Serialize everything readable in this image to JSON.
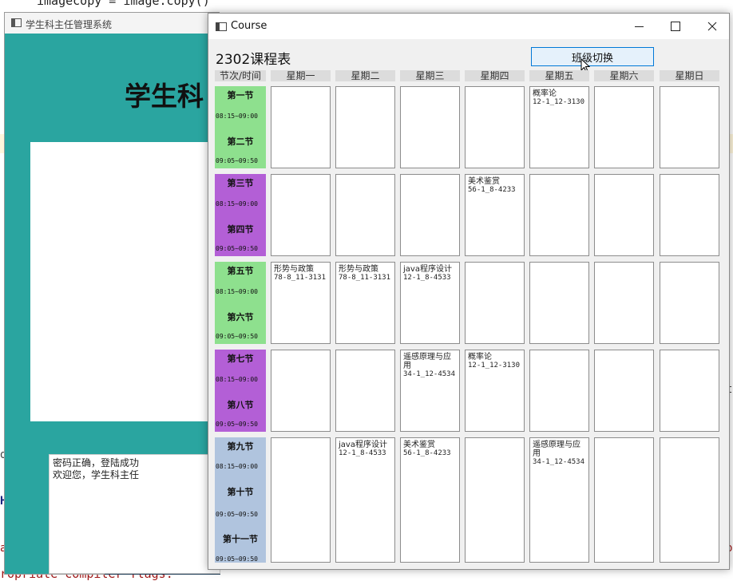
{
  "background": {
    "code_top": "imagecopy = image.copy()",
    "code_bottom": "ropriate compiler flags.",
    "right_fragment": "t",
    "right_fragment_b": "b",
    "left_fragment_d": "d",
    "left_fragment_h": "H",
    "left_fragment_a": "ar"
  },
  "login_window": {
    "title": "学生科主任管理系统",
    "banner": "学生科",
    "message_line1": "密码正确，登陆成功",
    "message_line2": "欢迎您，学生科主任"
  },
  "course_window": {
    "title": "Course",
    "table_title": "2302课程表",
    "switch_button": "班级切换",
    "headers": [
      "节次/时间",
      "星期一",
      "星期二",
      "星期三",
      "星期四",
      "星期五",
      "星期六",
      "星期日"
    ],
    "blocks": [
      {
        "p1": "第一节",
        "t1": "08:15~09:00",
        "p2": "第二节",
        "t2": "09:05~09:50",
        "color": "#8ee08e"
      },
      {
        "p1": "第三节",
        "t1": "08:15~09:00",
        "p2": "第四节",
        "t2": "09:05~09:50",
        "color": "#b35fd6"
      },
      {
        "p1": "第五节",
        "t1": "08:15~09:00",
        "p2": "第六节",
        "t2": "09:05~09:50",
        "color": "#8ee08e"
      },
      {
        "p1": "第七节",
        "t1": "08:15~09:00",
        "p2": "第八节",
        "t2": "09:05~09:50",
        "color": "#b35fd6"
      },
      {
        "p1": "第九节",
        "t1": "08:15~09:00",
        "p2": "第十节",
        "t2": "09:05~09:50",
        "p3": "第十一节",
        "t3": "09:05~09:50",
        "color": "#b0c4de"
      }
    ],
    "cells": [
      [
        "",
        "",
        "",
        "",
        {
          "name": "概率论",
          "room": "12-1_12-3130"
        },
        "",
        ""
      ],
      [
        "",
        "",
        "",
        {
          "name": "美术鉴赏",
          "room": "56-1_8-4233"
        },
        "",
        "",
        ""
      ],
      [
        {
          "name": "形势与政策",
          "room": "78-8_11-3131"
        },
        {
          "name": "形势与政策",
          "room": "78-8_11-3131"
        },
        {
          "name": "java程序设计",
          "room": "12-1_8-4533"
        },
        "",
        "",
        "",
        ""
      ],
      [
        "",
        "",
        {
          "name": "遥感原理与应用",
          "room": "34-1_12-4534"
        },
        {
          "name": "概率论",
          "room": "12-1_12-3130"
        },
        "",
        "",
        ""
      ],
      [
        "",
        {
          "name": "java程序设计",
          "room": "12-1_8-4533"
        },
        {
          "name": "美术鉴赏",
          "room": "56-1_8-4233"
        },
        "",
        {
          "name": "遥感原理与应用",
          "room": "34-1_12-4534"
        },
        "",
        ""
      ]
    ]
  }
}
